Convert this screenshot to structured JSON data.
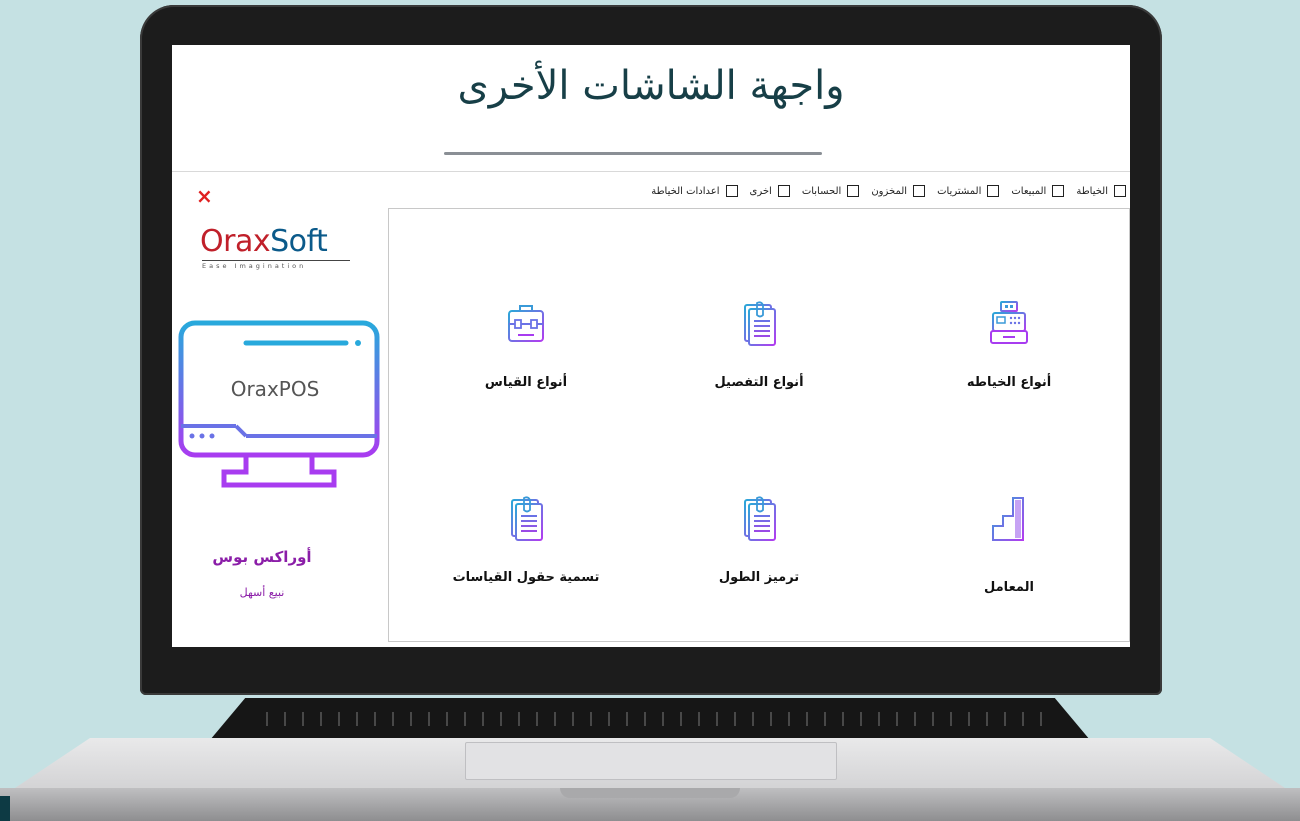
{
  "headline": "واجهة الشاشات الأخرى",
  "tabs": [
    {
      "label": "الخياطة"
    },
    {
      "label": "المبيعات"
    },
    {
      "label": "المشتريات"
    },
    {
      "label": "المخزون"
    },
    {
      "label": "الحسابات"
    },
    {
      "label": "اخرى"
    },
    {
      "label": "اعدادات الخياطة"
    }
  ],
  "sidebar": {
    "close": "×",
    "logo_part1": "Orax",
    "logo_part2": "Soft",
    "tagline": "Ease Imagination",
    "monitor_label": "OraxPOS",
    "brand": "أوراكس بوس",
    "slogan": "نبيع أسهل"
  },
  "tiles": [
    {
      "label": "أنواع الخياطه",
      "icon": "cash-register-icon"
    },
    {
      "label": "أنواع التفصيل",
      "icon": "document-icon"
    },
    {
      "label": "أنواع القياس",
      "icon": "toolbox-icon"
    },
    {
      "label": "المعامل",
      "icon": "bar-chart-icon"
    },
    {
      "label": "ترميز الطول",
      "icon": "document-icon"
    },
    {
      "label": "تسمية حقول القياسات",
      "icon": "document-icon"
    }
  ],
  "colors": {
    "accent_gradient_start": "#2aa8d8",
    "accent_gradient_end": "#b33cf0",
    "brand_purple": "#8b1ea8",
    "close_red": "#e02020",
    "background": "#c5e1e3"
  }
}
